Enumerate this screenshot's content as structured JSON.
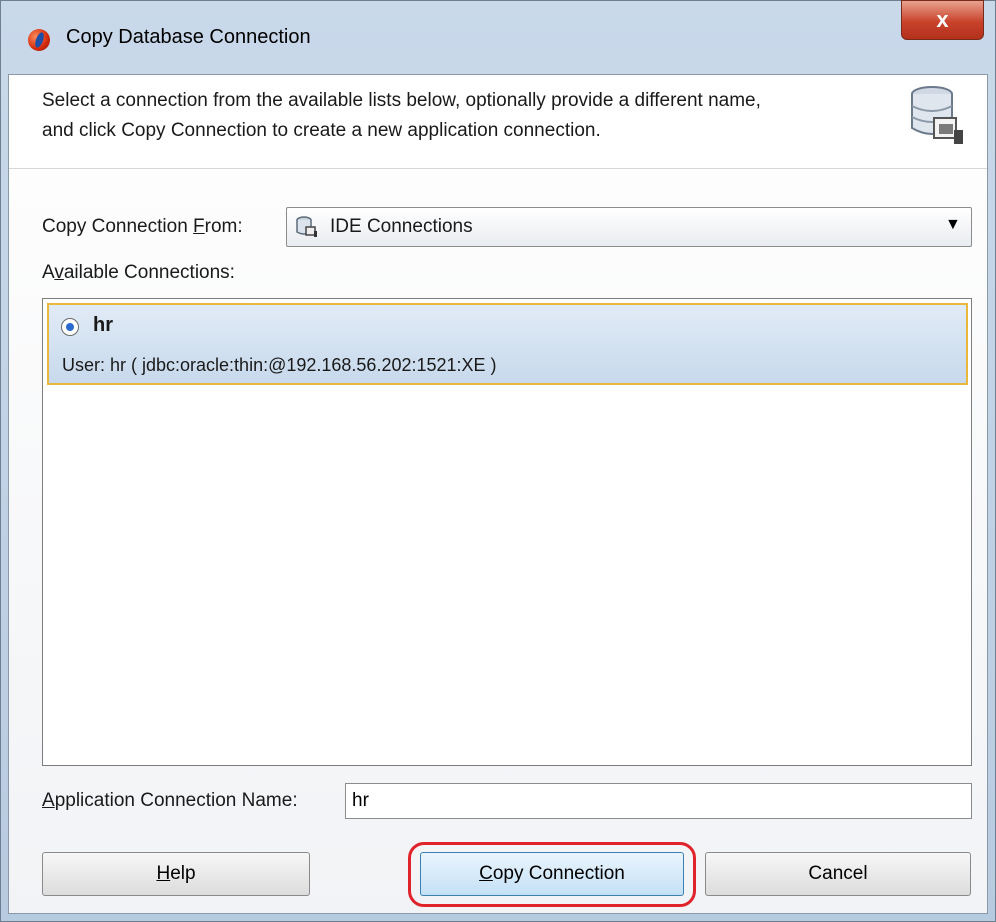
{
  "window": {
    "title": "Copy Database Connection",
    "close_label": "x"
  },
  "header": {
    "description_line1": "Select a connection from the available lists below, optionally provide a different name,",
    "description_line2": "and click Copy Connection to create a new application connection."
  },
  "copy_from": {
    "label_before": "Copy Connection ",
    "label_mnemonic": "F",
    "label_after": "rom:",
    "selected": "IDE Connections",
    "icon": "database-connections-icon"
  },
  "available": {
    "label_before": "A",
    "label_mnemonic": "v",
    "label_after": "ailable Connections:",
    "connections": [
      {
        "name": "hr",
        "detail": "User: hr ( jdbc:oracle:thin:@192.168.56.202:1521:XE )",
        "selected": true
      }
    ]
  },
  "app_connection_name": {
    "label_mnemonic": "A",
    "label_after": "pplication Connection Name:",
    "value": "hr"
  },
  "buttons": {
    "help_mnemonic": "H",
    "help_after": "elp",
    "copy_mnemonic": "C",
    "copy_after": "opy Connection",
    "cancel": "Cancel"
  },
  "colors": {
    "selection_border": "#e9b83a",
    "highlight_annotation": "#e0222a",
    "close_button": "#c9432b"
  }
}
